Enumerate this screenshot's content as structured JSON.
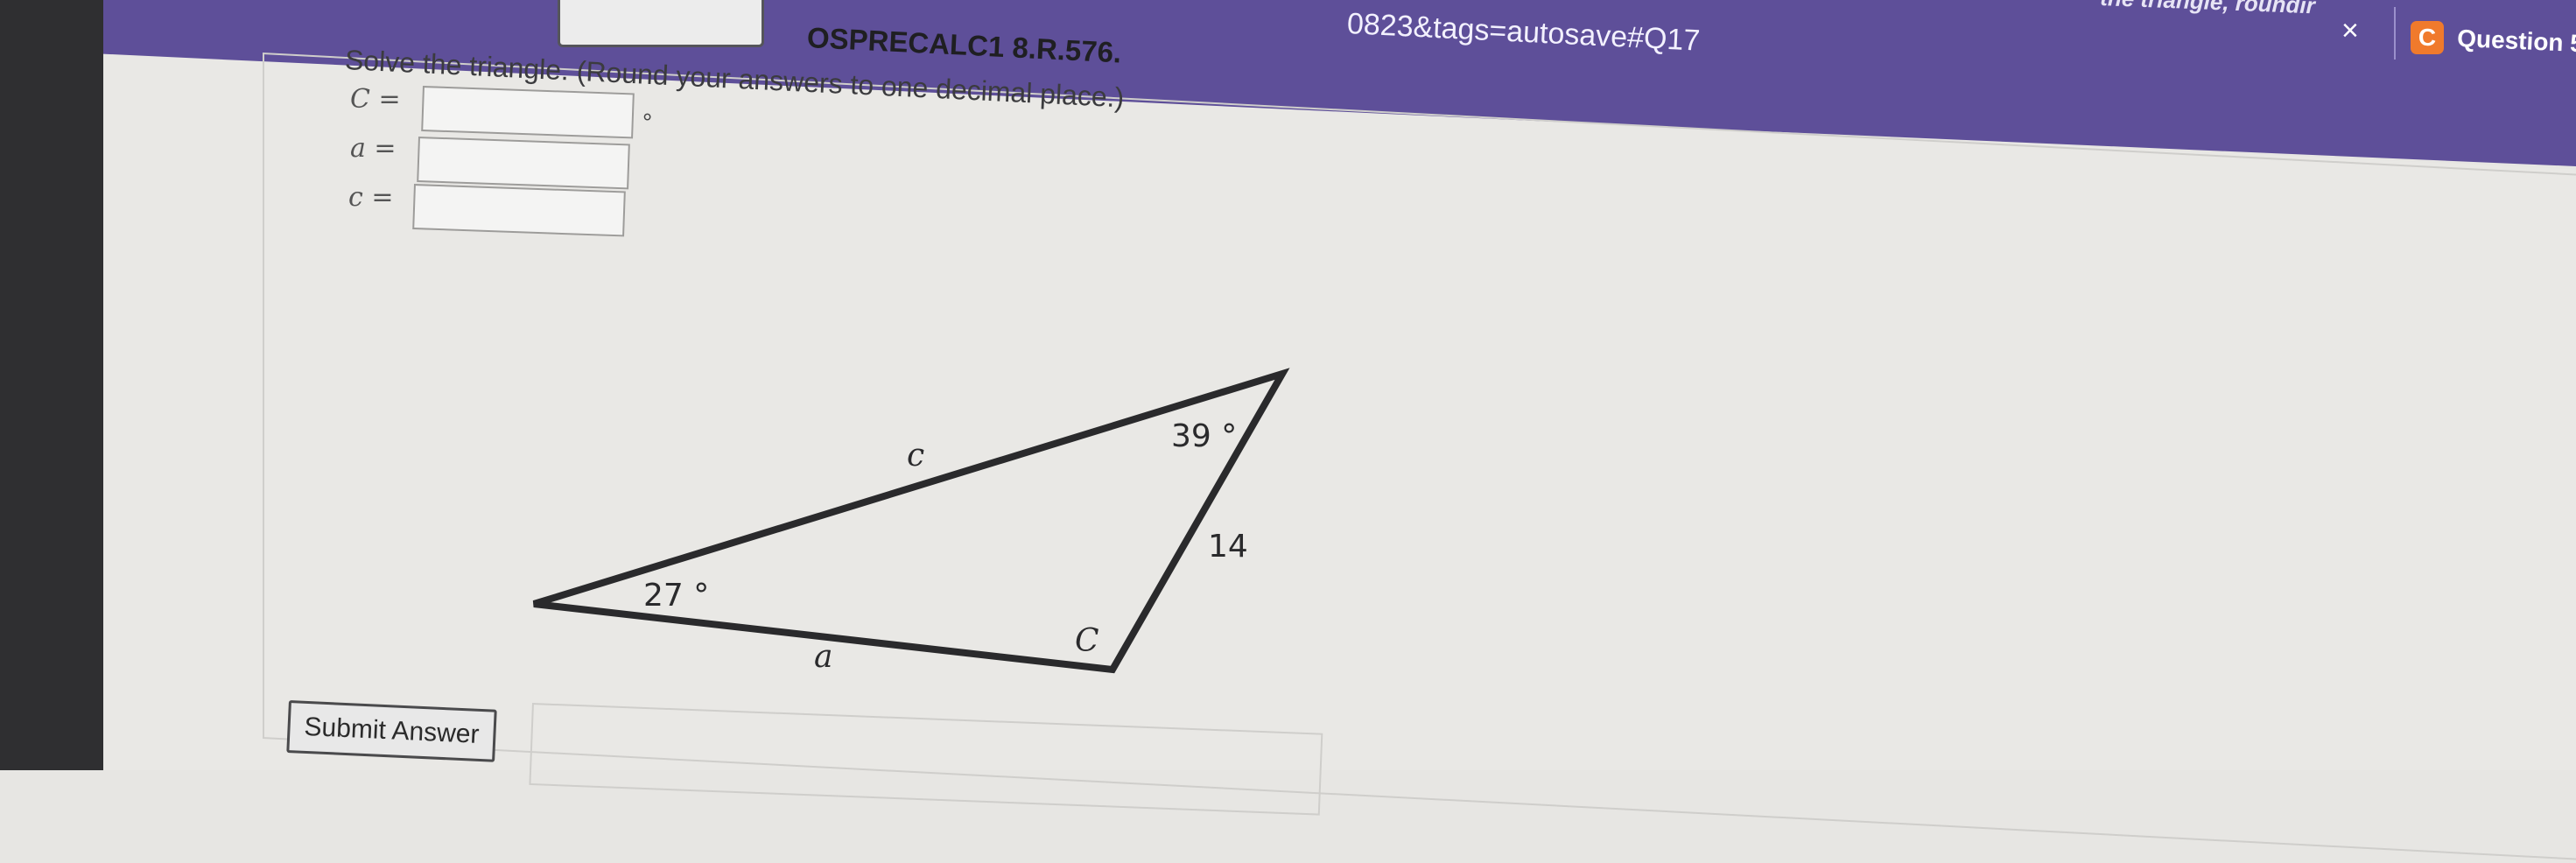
{
  "browser": {
    "url_fragment": "0823&tags=autosave#Q17",
    "tab_title": "the triangle, roundir",
    "tab_close": "×",
    "next_tab_icon": "C",
    "next_tab_title": "Question 5"
  },
  "question": {
    "code": "OSPRECALC1 8.R.576.",
    "instruction": "Solve the triangle. (Round your answers to one decimal place.)",
    "answers": [
      {
        "label": "C =",
        "value": "",
        "unit": "°"
      },
      {
        "label": "a =",
        "value": "",
        "unit": ""
      },
      {
        "label": "c =",
        "value": "",
        "unit": ""
      }
    ]
  },
  "figure": {
    "angle_a_label": "27 °",
    "angle_b_label": "39 °",
    "side_label_c": "c",
    "side_label_b": "14",
    "side_label_a": "a",
    "vertex_label_c": "C"
  },
  "actions": {
    "submit_label": "Submit Answer"
  }
}
